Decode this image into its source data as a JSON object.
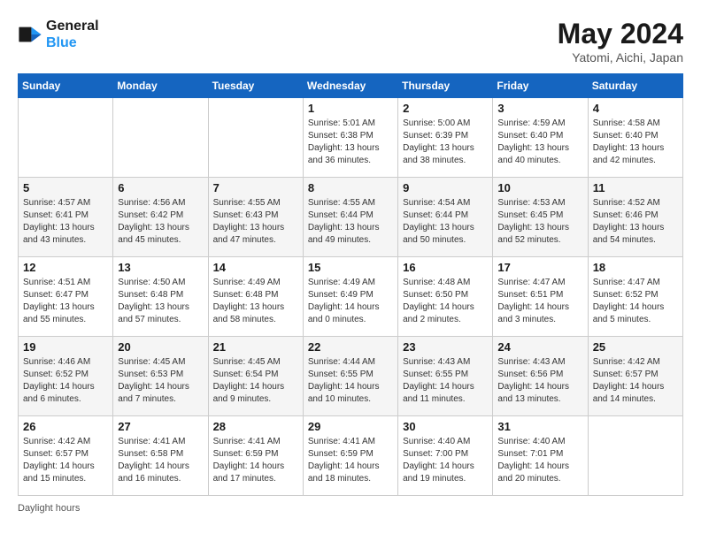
{
  "header": {
    "logo_line1": "General",
    "logo_line2": "Blue",
    "month_title": "May 2024",
    "location": "Yatomi, Aichi, Japan"
  },
  "days_of_week": [
    "Sunday",
    "Monday",
    "Tuesday",
    "Wednesday",
    "Thursday",
    "Friday",
    "Saturday"
  ],
  "weeks": [
    [
      {
        "day": "",
        "info": ""
      },
      {
        "day": "",
        "info": ""
      },
      {
        "day": "",
        "info": ""
      },
      {
        "day": "1",
        "info": "Sunrise: 5:01 AM\nSunset: 6:38 PM\nDaylight: 13 hours\nand 36 minutes."
      },
      {
        "day": "2",
        "info": "Sunrise: 5:00 AM\nSunset: 6:39 PM\nDaylight: 13 hours\nand 38 minutes."
      },
      {
        "day": "3",
        "info": "Sunrise: 4:59 AM\nSunset: 6:40 PM\nDaylight: 13 hours\nand 40 minutes."
      },
      {
        "day": "4",
        "info": "Sunrise: 4:58 AM\nSunset: 6:40 PM\nDaylight: 13 hours\nand 42 minutes."
      }
    ],
    [
      {
        "day": "5",
        "info": "Sunrise: 4:57 AM\nSunset: 6:41 PM\nDaylight: 13 hours\nand 43 minutes."
      },
      {
        "day": "6",
        "info": "Sunrise: 4:56 AM\nSunset: 6:42 PM\nDaylight: 13 hours\nand 45 minutes."
      },
      {
        "day": "7",
        "info": "Sunrise: 4:55 AM\nSunset: 6:43 PM\nDaylight: 13 hours\nand 47 minutes."
      },
      {
        "day": "8",
        "info": "Sunrise: 4:55 AM\nSunset: 6:44 PM\nDaylight: 13 hours\nand 49 minutes."
      },
      {
        "day": "9",
        "info": "Sunrise: 4:54 AM\nSunset: 6:44 PM\nDaylight: 13 hours\nand 50 minutes."
      },
      {
        "day": "10",
        "info": "Sunrise: 4:53 AM\nSunset: 6:45 PM\nDaylight: 13 hours\nand 52 minutes."
      },
      {
        "day": "11",
        "info": "Sunrise: 4:52 AM\nSunset: 6:46 PM\nDaylight: 13 hours\nand 54 minutes."
      }
    ],
    [
      {
        "day": "12",
        "info": "Sunrise: 4:51 AM\nSunset: 6:47 PM\nDaylight: 13 hours\nand 55 minutes."
      },
      {
        "day": "13",
        "info": "Sunrise: 4:50 AM\nSunset: 6:48 PM\nDaylight: 13 hours\nand 57 minutes."
      },
      {
        "day": "14",
        "info": "Sunrise: 4:49 AM\nSunset: 6:48 PM\nDaylight: 13 hours\nand 58 minutes."
      },
      {
        "day": "15",
        "info": "Sunrise: 4:49 AM\nSunset: 6:49 PM\nDaylight: 14 hours\nand 0 minutes."
      },
      {
        "day": "16",
        "info": "Sunrise: 4:48 AM\nSunset: 6:50 PM\nDaylight: 14 hours\nand 2 minutes."
      },
      {
        "day": "17",
        "info": "Sunrise: 4:47 AM\nSunset: 6:51 PM\nDaylight: 14 hours\nand 3 minutes."
      },
      {
        "day": "18",
        "info": "Sunrise: 4:47 AM\nSunset: 6:52 PM\nDaylight: 14 hours\nand 5 minutes."
      }
    ],
    [
      {
        "day": "19",
        "info": "Sunrise: 4:46 AM\nSunset: 6:52 PM\nDaylight: 14 hours\nand 6 minutes."
      },
      {
        "day": "20",
        "info": "Sunrise: 4:45 AM\nSunset: 6:53 PM\nDaylight: 14 hours\nand 7 minutes."
      },
      {
        "day": "21",
        "info": "Sunrise: 4:45 AM\nSunset: 6:54 PM\nDaylight: 14 hours\nand 9 minutes."
      },
      {
        "day": "22",
        "info": "Sunrise: 4:44 AM\nSunset: 6:55 PM\nDaylight: 14 hours\nand 10 minutes."
      },
      {
        "day": "23",
        "info": "Sunrise: 4:43 AM\nSunset: 6:55 PM\nDaylight: 14 hours\nand 11 minutes."
      },
      {
        "day": "24",
        "info": "Sunrise: 4:43 AM\nSunset: 6:56 PM\nDaylight: 14 hours\nand 13 minutes."
      },
      {
        "day": "25",
        "info": "Sunrise: 4:42 AM\nSunset: 6:57 PM\nDaylight: 14 hours\nand 14 minutes."
      }
    ],
    [
      {
        "day": "26",
        "info": "Sunrise: 4:42 AM\nSunset: 6:57 PM\nDaylight: 14 hours\nand 15 minutes."
      },
      {
        "day": "27",
        "info": "Sunrise: 4:41 AM\nSunset: 6:58 PM\nDaylight: 14 hours\nand 16 minutes."
      },
      {
        "day": "28",
        "info": "Sunrise: 4:41 AM\nSunset: 6:59 PM\nDaylight: 14 hours\nand 17 minutes."
      },
      {
        "day": "29",
        "info": "Sunrise: 4:41 AM\nSunset: 6:59 PM\nDaylight: 14 hours\nand 18 minutes."
      },
      {
        "day": "30",
        "info": "Sunrise: 4:40 AM\nSunset: 7:00 PM\nDaylight: 14 hours\nand 19 minutes."
      },
      {
        "day": "31",
        "info": "Sunrise: 4:40 AM\nSunset: 7:01 PM\nDaylight: 14 hours\nand 20 minutes."
      },
      {
        "day": "",
        "info": ""
      }
    ]
  ],
  "footer": {
    "daylight_hours_label": "Daylight hours"
  }
}
